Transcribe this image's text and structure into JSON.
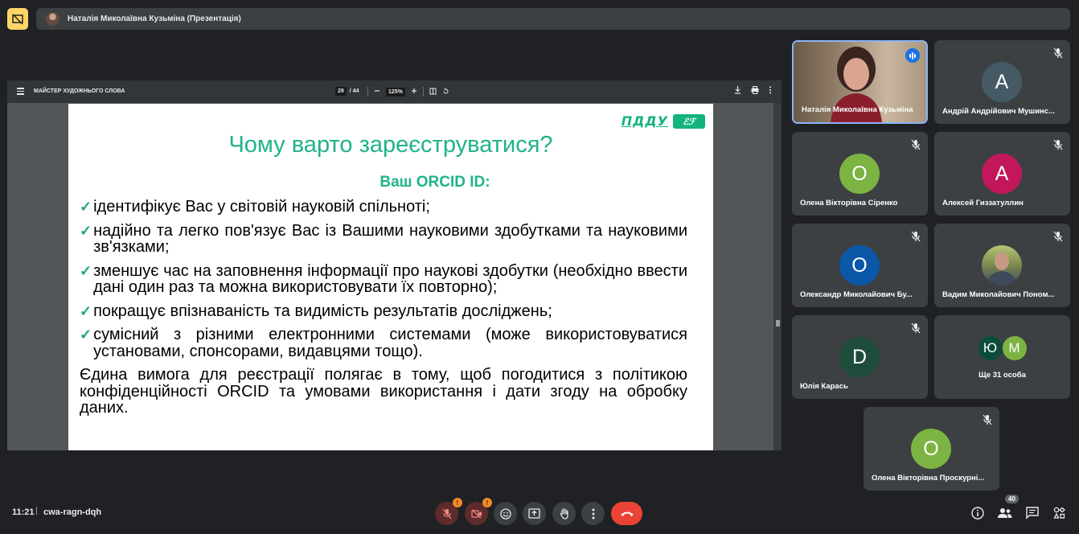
{
  "header": {
    "presenter_title": "Наталія Миколаївна Кузьміна (Презентація)"
  },
  "pdf_viewer": {
    "document_title": "МАЙСТЕР ХУДОЖНЬОГО СЛОВА",
    "current_page": "29",
    "total_pages": "/ 44",
    "zoom": "125%"
  },
  "slide": {
    "logo_text": "ПДДУ",
    "logo_mark": "ℰℱ",
    "title": "Чому варто зареєструватися?",
    "subtitle": "Ваш ORCID ID:",
    "check_symbol": "✓",
    "items": [
      "ідентифікує Вас у світовій науковій спільноті;",
      "надійно та легко пов'язує Вас із Вашими науковими здобутками та науковими зв'язками;",
      "зменшує час на заповнення інформації про наукові здобутки (необхідно ввести дані один раз та можна використовувати їх повторно);",
      "покращує впізнаваність та видимість результатів досліджень;",
      "сумісний з різними електронними системами (може використовуватися установами, спонсорами, видавцями тощо)."
    ],
    "final": "Єдина вимога для реєстрації полягає в тому, щоб погодитися з політикою конфіденційності ORCID та умовами використання і дати згоду на обробку даних."
  },
  "participants": [
    {
      "name": "Наталія Миколаївна Кузьміна",
      "initial": "",
      "color": ""
    },
    {
      "name": "Андрій Андрійович Мушинс...",
      "initial": "A",
      "color": "#455a64"
    },
    {
      "name": "Олена Вікторівна Сіренко",
      "initial": "O",
      "color": "#7cb342"
    },
    {
      "name": "Алексей Гиззатуллин",
      "initial": "A",
      "color": "#c2185b"
    },
    {
      "name": "Олександр Миколайович Бу...",
      "initial": "O",
      "color": "#0b57a8"
    },
    {
      "name": "Вадим Миколайович Поном...",
      "initial": "",
      "color": ""
    },
    {
      "name": "Юлія Карась",
      "initial": "D",
      "color": "#1e4d3b"
    },
    {
      "name": "Олена Вікторівна Проскурні...",
      "initial": "O",
      "color": "#7cb342"
    }
  ],
  "others": {
    "initials": [
      "Ю",
      "M"
    ],
    "colors": [
      "#0b4d3a",
      "#7cb342"
    ],
    "label": "Ще 31 особа"
  },
  "bottom": {
    "time": "11:21",
    "separator": "|",
    "meeting_code": "cwa-ragn-dqh",
    "warn": "!",
    "participant_count": "40"
  },
  "colors": {
    "accent": "#1fb38a",
    "speaking_border": "#8ab4f8",
    "hangup": "#ea4335"
  }
}
